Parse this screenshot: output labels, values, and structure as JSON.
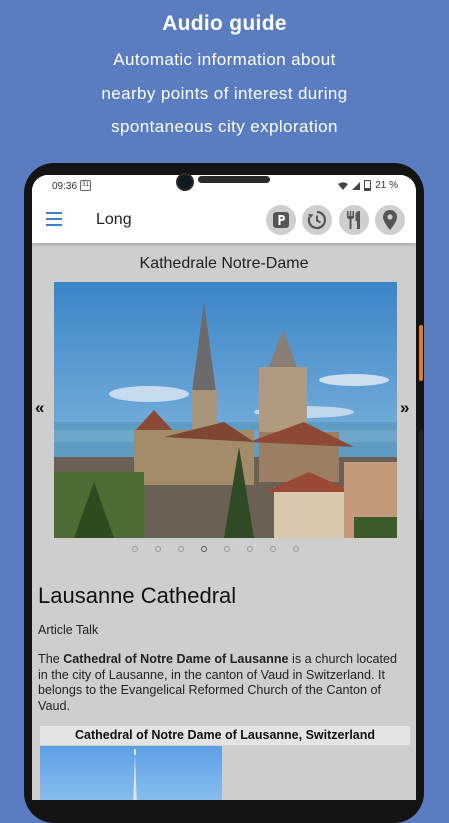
{
  "promo": {
    "title": "Audio guide",
    "line1": "Automatic information about",
    "line2": "nearby points of interest during",
    "line3": "spontaneous city exploration"
  },
  "statusbar": {
    "time": "09:36",
    "battery": "21 %"
  },
  "appbar": {
    "title": "Long",
    "actions": [
      "parking-icon",
      "history-icon",
      "restaurant-icon",
      "location-pin-icon"
    ]
  },
  "place": {
    "name": "Kathedrale Notre-Dame"
  },
  "carousel": {
    "prev": "«",
    "next": "»",
    "page_count": 8,
    "active_index": 3
  },
  "article": {
    "title": "Lausanne Cathedral",
    "tabs": "Article Talk",
    "body_intro": "The ",
    "body_bold": "Cathedral of Notre Dame of Lausanne",
    "body_rest": " is a church located in the city of Lausanne, in the canton of Vaud in Switzerland. It belongs to the Evangelical Reformed Church of the Canton of Vaud.",
    "caption": "Cathedral of Notre Dame of Lausanne, Switzerland"
  },
  "colors": {
    "background": "#5a7dc2",
    "accent": "#3b82d6",
    "content_bg": "#cecece"
  }
}
